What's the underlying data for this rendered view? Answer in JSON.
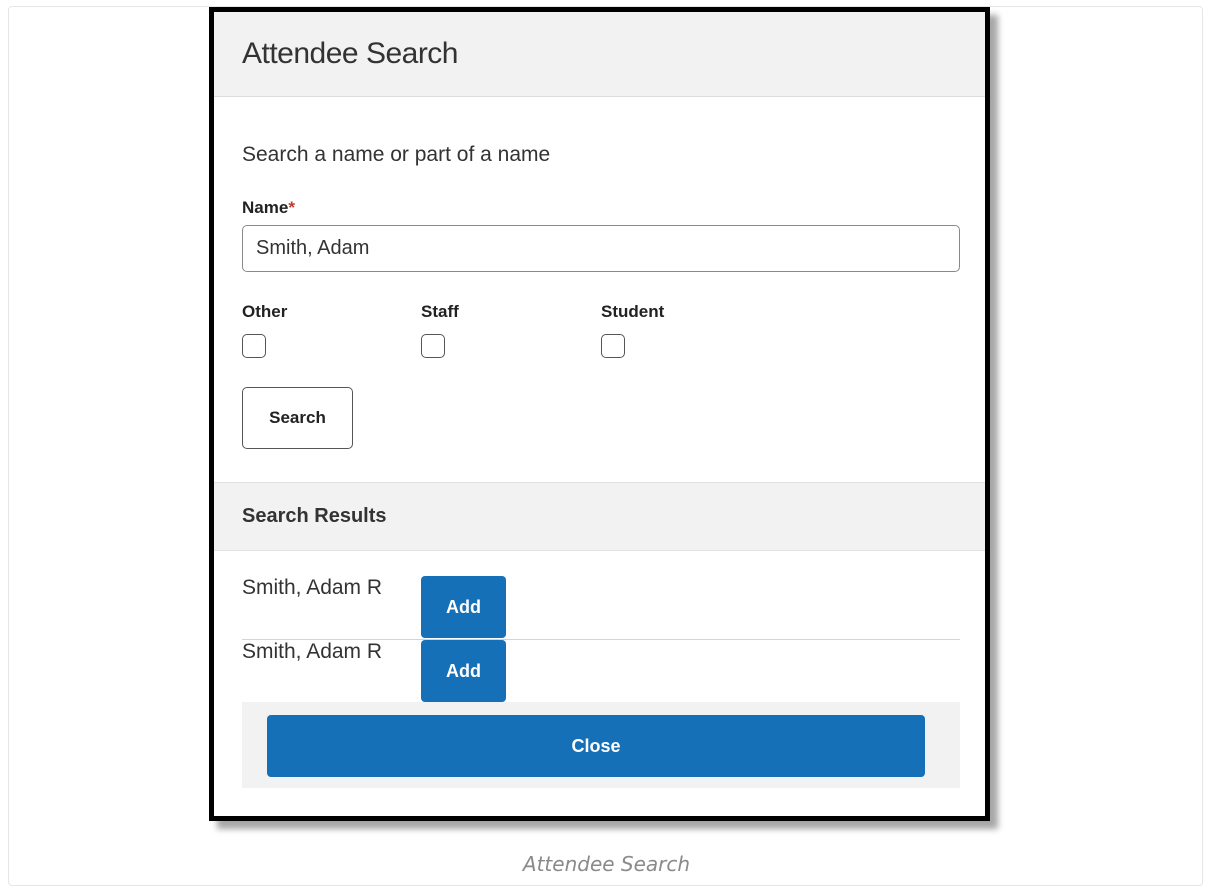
{
  "dialog": {
    "title": "Attendee Search",
    "instruction": "Search a name or part of a name",
    "name_label": "Name",
    "required_mark": "*",
    "name_value": "Smith, Adam",
    "checkboxes": [
      {
        "label": "Other",
        "checked": false
      },
      {
        "label": "Staff",
        "checked": false
      },
      {
        "label": "Student",
        "checked": false
      }
    ],
    "search_label": "Search",
    "results_title": "Search Results",
    "results": [
      {
        "name": "Smith, Adam R",
        "action": "Add"
      },
      {
        "name": "Smith, Adam R",
        "action": "Add"
      }
    ],
    "close_label": "Close"
  },
  "caption": "Attendee Search",
  "colors": {
    "accent": "#1570b8",
    "header_bg": "#f2f2f2",
    "required": "#c0392b"
  }
}
